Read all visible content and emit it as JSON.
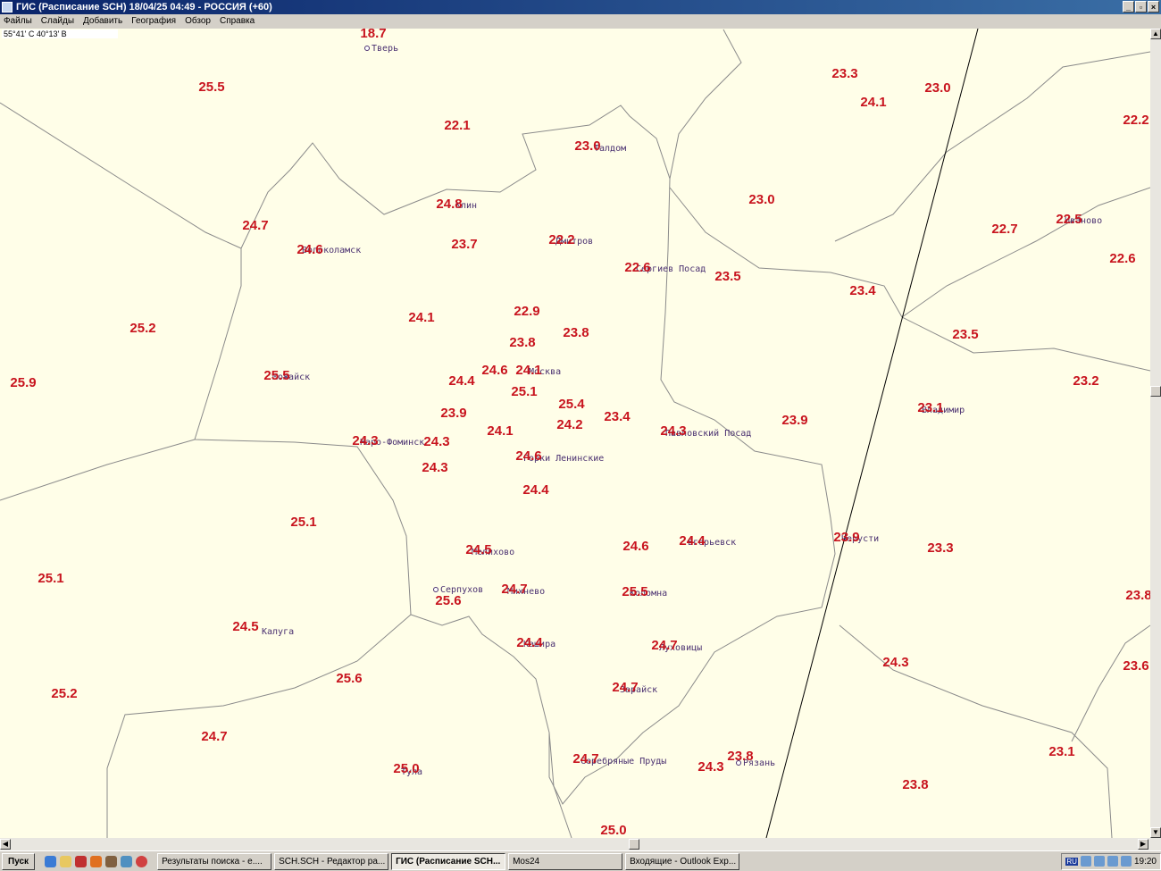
{
  "window": {
    "title": "ГИС (Расписание SCH) 18/04/25 04:49 - РОССИЯ (+60)",
    "controls": [
      "_",
      "▫",
      "×"
    ]
  },
  "menu": [
    "Файлы",
    "Слайды",
    "Добавить",
    "География",
    "Обзор",
    "Справка"
  ],
  "coordinates": "55°41' С 40°13' В",
  "map": {
    "values": [
      "18.7",
      "25.5",
      "22.1",
      "23.0",
      "23.3",
      "24.1",
      "23.0",
      "22.2",
      "24.8",
      "24.7",
      "23.0",
      "22.7",
      "22.5",
      "22.6",
      "24.6",
      "23.7",
      "22.2",
      "22.6",
      "23.5",
      "23.4",
      "24.1",
      "22.9",
      "23.8",
      "23.8",
      "25.2",
      "23.5",
      "25.9",
      "25.5",
      "24.6",
      "24.1",
      "24.4",
      "25.1",
      "25.4",
      "23.2",
      "23.1",
      "23.9",
      "24.2",
      "23.4",
      "24.3",
      "23.9",
      "24.1",
      "24.3",
      "24.3",
      "24.3",
      "24.6",
      "24.4",
      "25.1",
      "25.1",
      "24.5",
      "24.6",
      "24.4",
      "23.9",
      "23.3",
      "24.7",
      "25.6",
      "25.5",
      "23.8",
      "24.5",
      "24.4",
      "24.7",
      "23.6",
      "24.3",
      "25.6",
      "25.2",
      "24.7",
      "24.7",
      "23.8",
      "24.7",
      "24.3",
      "23.1",
      "25.0",
      "23.8",
      "25.0"
    ],
    "cities": [
      "Тверь",
      "Талдом",
      "Клин",
      "Волоколамск",
      "Дмитров",
      "Сергиев Посад",
      "Иваново",
      "Можайск",
      "Москва",
      "Наро-Фоминск",
      "Горки Ленинские",
      "Павловский Посад",
      "Владимир",
      "Мелихово",
      "Егорьевск",
      "Черусти",
      "Серпухов",
      "Михнево",
      "Коломна",
      "Калуга",
      "Кашира",
      "Луховицы",
      "Зарайск",
      "Серебряные Пруды",
      "Рязань",
      "Тула"
    ],
    "value_color": "#c8141e"
  },
  "taskbar": {
    "start": "Пуск",
    "tasks": [
      "Результаты поиска - е....",
      "SCH.SCH - Редактор ра...",
      "ГИС (Расписание SCH...",
      "Mos24",
      "Входящие - Outlook Exp..."
    ],
    "active_task": 2,
    "lang": "RU",
    "clock": "19:20"
  }
}
